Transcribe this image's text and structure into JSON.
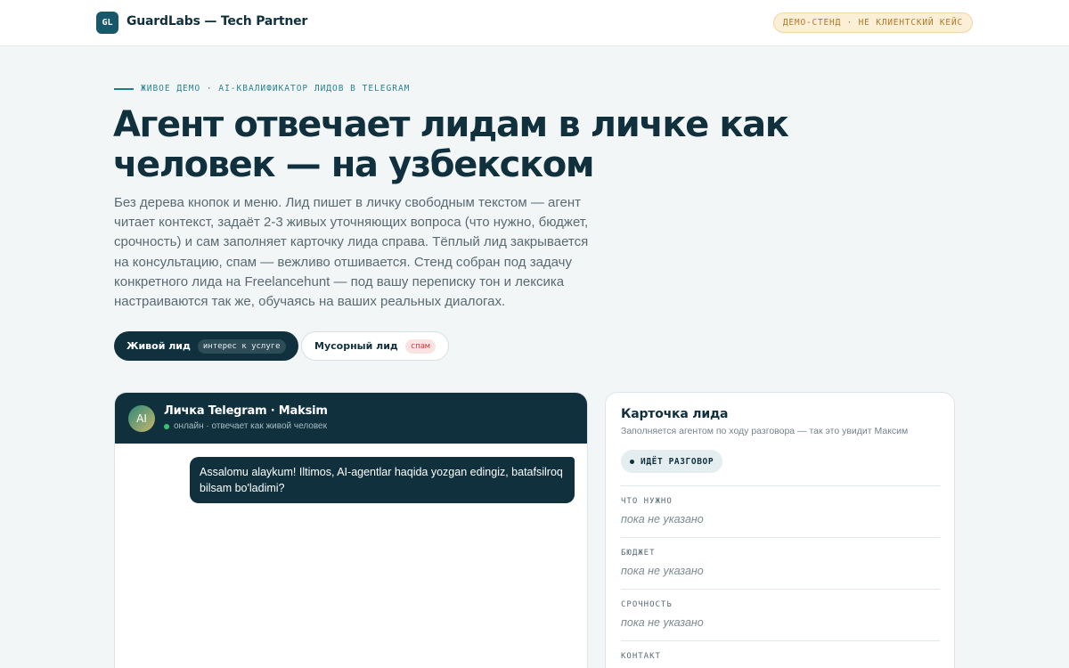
{
  "header": {
    "logo_text": "GL",
    "brand": "GuardLabs — Tech Partner",
    "demo_badge": "ДЕМО-СТЕНД · НЕ КЛИЕНТСКИЙ КЕЙС"
  },
  "hero": {
    "eyebrow": "ЖИВОЕ ДЕМО · AI-КВАЛИФИКАТОР ЛИДОВ В TELEGRAM",
    "headline": "Агент отвечает лидам в личке как человек — на узбекском",
    "lead": "Без дерева кнопок и меню. Лид пишет в личку свободным текстом — агент читает контекст, задаёт 2-3 живых уточняющих вопроса (что нужно, бюджет, срочность) и сам заполняет карточку лида справа. Тёплый лид закрывается на консультацию, спам — вежливо отшивается. Стенд собран под задачу конкретного лида на Freelancehunt — под вашу переписку тон и лексика настраиваются так же, обучаясь на ваших реальных диалогах."
  },
  "modes": [
    {
      "label": "Живой лид",
      "chip": "интерес к услуге",
      "active": true
    },
    {
      "label": "Мусорный лид",
      "chip": "спам",
      "active": false
    }
  ],
  "chat": {
    "avatar": "AI",
    "title": "Личка Telegram · Maksim",
    "status": "онлайн · отвечает как живой человек",
    "messages": [
      {
        "from": "lead",
        "text": "Assalomu alaykum! Iltimos, AI-agentlar haqida yozgan edingiz, batafsilroq bilsam bo'ladimi?"
      }
    ]
  },
  "card": {
    "title": "Карточка лида",
    "subtitle": "Заполняется агентом по ходу разговора — так это увидит Максим",
    "status": "ИДЁТ РАЗГОВОР",
    "fields": [
      {
        "label": "ЧТО НУЖНО",
        "value": "пока не указано"
      },
      {
        "label": "БЮДЖЕТ",
        "value": "пока не указано"
      },
      {
        "label": "СРОЧНОСТЬ",
        "value": "пока не указано"
      },
      {
        "label": "КОНТАКТ",
        "value": ""
      }
    ]
  },
  "colors": {
    "primary_dark": "#10303e",
    "accent_teal": "#1d7f8e",
    "badge_amber": "#b07a25",
    "online_green": "#38c46e",
    "spam_red": "#c74545"
  }
}
